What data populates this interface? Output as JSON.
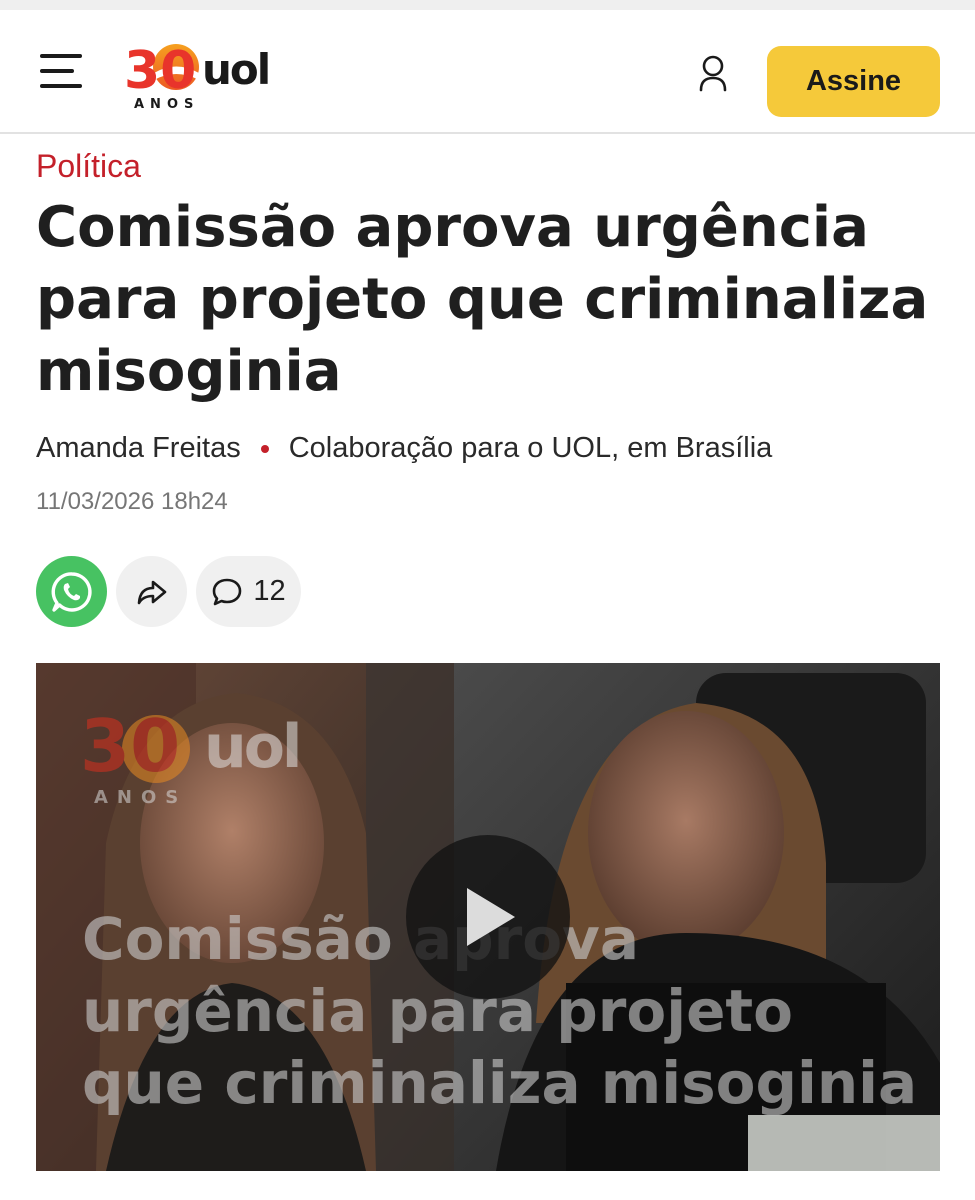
{
  "header": {
    "logo_number": "30",
    "logo_brand": "uol",
    "logo_sub": "ANOS",
    "subscribe_label": "Assine"
  },
  "article": {
    "section": "Política",
    "title": "Comissão aprova urgência para projeto que criminaliza misoginia",
    "author": "Amanda Freitas",
    "affiliation": "Colaboração para o UOL, em Brasília",
    "timestamp": "11/03/2026 18h24"
  },
  "share": {
    "comment_count": "12"
  },
  "video": {
    "overlay_title": "Comissão aprova urgência para projeto que criminaliza misoginia",
    "logo_number": "30",
    "logo_brand": "uol",
    "logo_sub": "ANOS"
  },
  "colors": {
    "accent_red": "#c4202a",
    "subscribe_yellow": "#f5c93a",
    "whatsapp_green": "#47c262",
    "logo_orange": "#f08a1c",
    "logo_red": "#e8342b"
  },
  "icons": [
    "menu-icon",
    "user-icon",
    "whatsapp-icon",
    "share-icon",
    "comment-icon",
    "play-icon"
  ]
}
